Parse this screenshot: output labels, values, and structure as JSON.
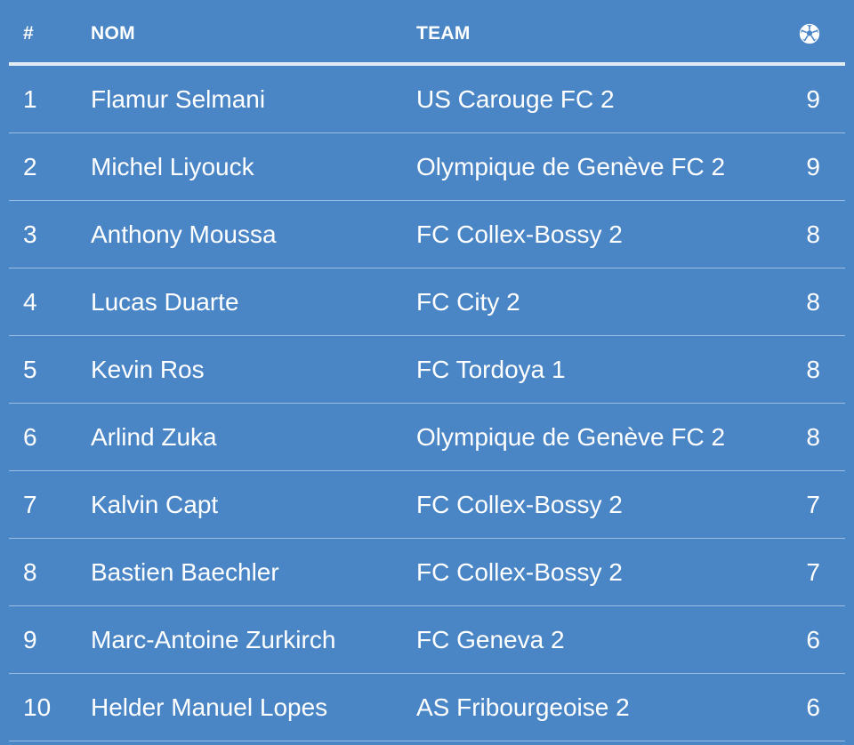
{
  "header": {
    "rank": "#",
    "name": "NOM",
    "team": "TEAM",
    "goals_icon": "soccer-ball-icon"
  },
  "rows": [
    {
      "rank": "1",
      "name": "Flamur Selmani",
      "team": "US Carouge FC 2",
      "goals": "9"
    },
    {
      "rank": "2",
      "name": "Michel Liyouck",
      "team": "Olympique de Genève FC 2",
      "goals": "9"
    },
    {
      "rank": "3",
      "name": "Anthony Moussa",
      "team": "FC Collex-Bossy 2",
      "goals": "8"
    },
    {
      "rank": "4",
      "name": "Lucas Duarte",
      "team": "FC City 2",
      "goals": "8"
    },
    {
      "rank": "5",
      "name": "Kevin Ros",
      "team": "FC Tordoya 1",
      "goals": "8"
    },
    {
      "rank": "6",
      "name": "Arlind Zuka",
      "team": "Olympique de Genève FC 2",
      "goals": "8"
    },
    {
      "rank": "7",
      "name": "Kalvin Capt",
      "team": "FC Collex-Bossy 2",
      "goals": "7"
    },
    {
      "rank": "8",
      "name": "Bastien Baechler",
      "team": "FC Collex-Bossy 2",
      "goals": "7"
    },
    {
      "rank": "9",
      "name": "Marc-Antoine Zurkirch",
      "team": "FC Geneva 2",
      "goals": "6"
    },
    {
      "rank": "10",
      "name": "Helder Manuel Lopes",
      "team": "AS Fribourgeoise 2",
      "goals": "6"
    }
  ],
  "colors": {
    "background": "#4a86c6",
    "text": "#ffffff",
    "header_rule": "#e3ebf5"
  }
}
